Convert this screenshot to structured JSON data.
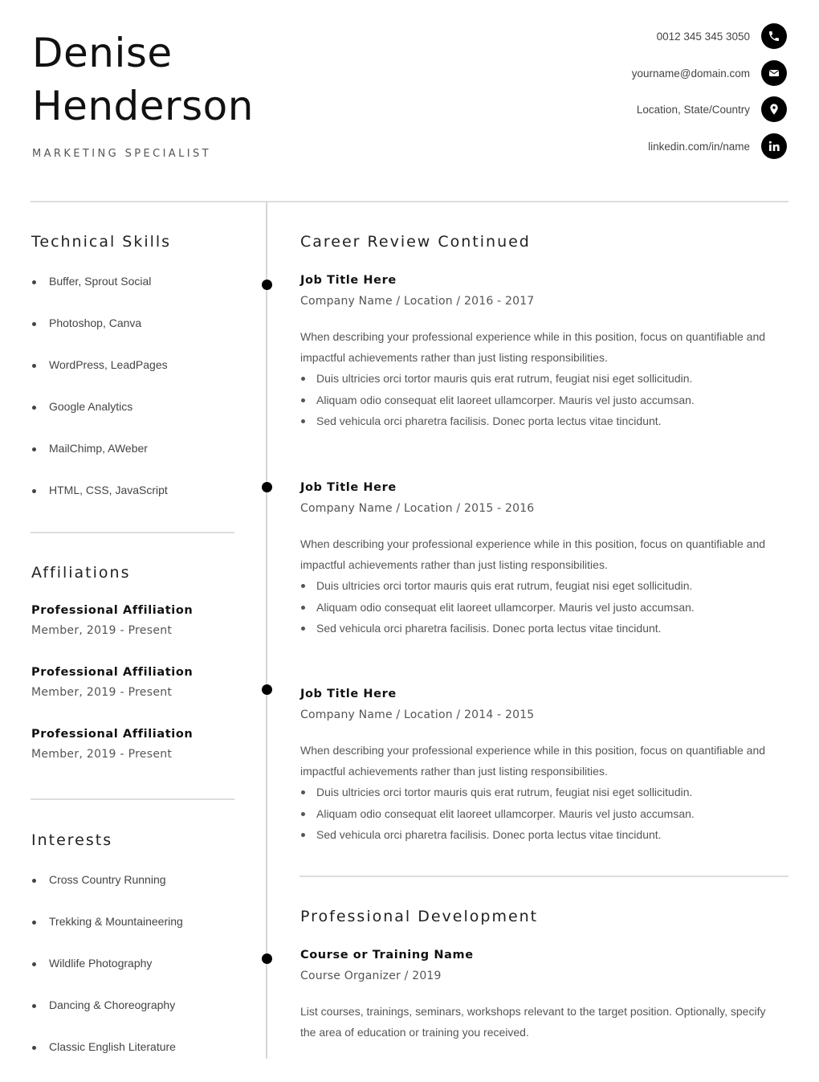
{
  "header": {
    "first_name": "Denise",
    "last_name": "Henderson",
    "role": "MARKETING SPECIALIST"
  },
  "contact": {
    "phone": "0012 345 345 3050",
    "email": "yourname@domain.com",
    "location": "Location, State/Country",
    "linkedin": "linkedin.com/in/name"
  },
  "skills": {
    "title": "Technical Skills",
    "items": [
      "Buffer, Sprout Social",
      "Photoshop, Canva",
      "WordPress, LeadPages",
      "Google Analytics",
      "MailChimp, AWeber",
      "HTML, CSS, JavaScript"
    ]
  },
  "affiliations": {
    "title": "Affiliations",
    "items": [
      {
        "name": "Professional Affiliation",
        "detail": "Member, 2019 - Present"
      },
      {
        "name": "Professional Affiliation",
        "detail": "Member, 2019 - Present"
      },
      {
        "name": "Professional Affiliation",
        "detail": "Member, 2019 - Present"
      }
    ]
  },
  "interests": {
    "title": "Interests",
    "items": [
      "Cross Country Running",
      "Trekking & Mountaineering",
      "Wildlife Photography",
      "Dancing & Choreography",
      "Classic English Literature"
    ]
  },
  "career": {
    "title": "Career Review Continued",
    "jobs": [
      {
        "title": "Job Title Here",
        "company": "Company Name / Location / 2016 - 2017",
        "desc": "When describing your professional experience while in this position, focus on quantifiable and impactful achievements rather than just listing responsibilities.",
        "bullets": [
          "Duis ultricies orci tortor mauris quis erat rutrum, feugiat nisi eget sollicitudin.",
          "Aliquam odio consequat elit laoreet ullamcorper. Mauris vel justo accumsan.",
          "Sed vehicula orci pharetra facilisis. Donec porta lectus vitae tincidunt."
        ]
      },
      {
        "title": "Job Title Here",
        "company": "Company Name / Location / 2015 - 2016",
        "desc": "When describing your professional experience while in this position, focus on quantifiable and impactful achievements rather than just listing responsibilities.",
        "bullets": [
          "Duis ultricies orci tortor mauris quis erat rutrum, feugiat nisi eget sollicitudin.",
          "Aliquam odio consequat elit laoreet ullamcorper. Mauris vel justo accumsan.",
          "Sed vehicula orci pharetra facilisis. Donec porta lectus vitae tincidunt."
        ]
      },
      {
        "title": "Job Title Here",
        "company": "Company Name / Location / 2014 - 2015",
        "desc": "When describing your professional experience while in this position, focus on quantifiable and impactful achievements rather than just listing responsibilities.",
        "bullets": [
          "Duis ultricies orci tortor mauris quis erat rutrum, feugiat nisi eget sollicitudin.",
          "Aliquam odio consequat elit laoreet ullamcorper. Mauris vel justo accumsan.",
          "Sed vehicula orci pharetra facilisis. Donec porta lectus vitae tincidunt."
        ]
      }
    ]
  },
  "development": {
    "title": "Professional Development",
    "course": "Course or Training Name",
    "organizer": "Course Organizer / 2019",
    "desc": "List courses, trainings, seminars, workshops relevant to the target position. Optionally, specify the area of education or training you received."
  }
}
